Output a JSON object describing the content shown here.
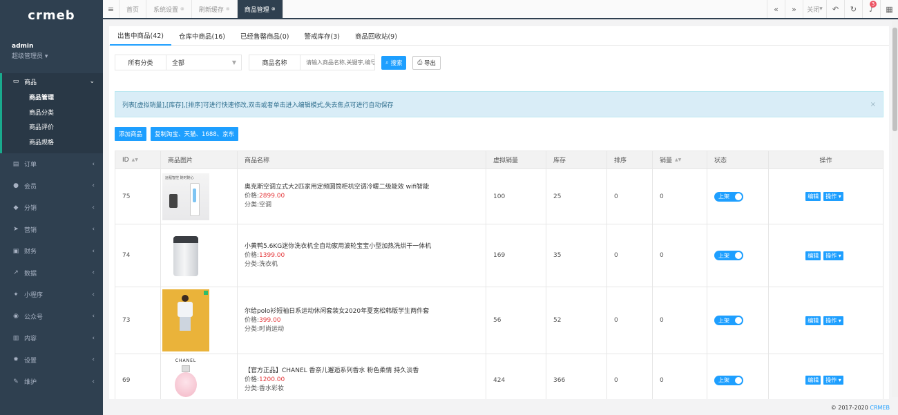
{
  "sidebar": {
    "logo": "crmeb",
    "user": {
      "name": "admin",
      "role": "超级管理员 ▾"
    },
    "active_group": {
      "label": "商品",
      "children": [
        {
          "label": "商品管理"
        },
        {
          "label": "商品分类"
        },
        {
          "label": "商品评价"
        },
        {
          "label": "商品规格"
        }
      ]
    },
    "items": [
      {
        "label": "订单",
        "icon": "order-icon"
      },
      {
        "label": "会员",
        "icon": "user-icon"
      },
      {
        "label": "分销",
        "icon": "users-icon"
      },
      {
        "label": "营销",
        "icon": "send-icon"
      },
      {
        "label": "财务",
        "icon": "money-icon"
      },
      {
        "label": "数据",
        "icon": "chart-icon"
      },
      {
        "label": "小程序",
        "icon": "miniapp-icon"
      },
      {
        "label": "公众号",
        "icon": "wechat-icon"
      },
      {
        "label": "内容",
        "icon": "book-icon"
      },
      {
        "label": "设置",
        "icon": "gear-icon"
      },
      {
        "label": "维护",
        "icon": "wrench-icon"
      }
    ]
  },
  "topbar": {
    "tabs": [
      {
        "label": "首页"
      },
      {
        "label": "系统设置"
      },
      {
        "label": "刷新缓存"
      },
      {
        "label": "商品管理"
      }
    ],
    "close_label": "关闭",
    "notifications": "3"
  },
  "sub_tabs": [
    {
      "label": "出售中商品(42)"
    },
    {
      "label": "仓库中商品(16)"
    },
    {
      "label": "已经售罄商品(0)"
    },
    {
      "label": "警戒库存(3)"
    },
    {
      "label": "商品回收站(9)"
    }
  ],
  "filters": {
    "category_label": "所有分类",
    "category_value": "全部",
    "name_label": "商品名称",
    "name_placeholder": "请输入商品名称,关键字,编号",
    "search_label": "搜索",
    "export_label": "导出"
  },
  "alert": "列表[虚拟销量],[库存],[排序]可进行快速修改,双击或者单击进入编辑模式,失去焦点可进行自动保存",
  "actions": {
    "add_label": "添加商品",
    "copy_label": "复制淘宝、天猫、1688、京东"
  },
  "table": {
    "headers": {
      "id": "ID",
      "image": "商品图片",
      "name": "商品名称",
      "virtual_sales": "虚拟销量",
      "stock": "库存",
      "sort": "排序",
      "sales": "销量",
      "status": "状态",
      "ops": "操作"
    },
    "price_prefix": "价格:",
    "category_prefix": "分类:",
    "status_label": "上架",
    "edit_label": "编辑",
    "op_label": "操作 ▾",
    "rows": [
      {
        "id": "75",
        "name": "奥克斯空调立式大2匹家用定频圆筒柜机空调冷暖二级能效 wifi智能",
        "price": "2899.00",
        "category": "空调",
        "virtual_sales": "100",
        "stock": "25",
        "sort": "0",
        "sales": "0",
        "image_text": "远程智控 随时随心"
      },
      {
        "id": "74",
        "name": "小黄鸭5.6KG迷你洗衣机全自动家用波轮宝宝小型加热洗烘干一体机",
        "price": "1399.00",
        "category": "洗衣机",
        "virtual_sales": "169",
        "stock": "35",
        "sort": "0",
        "sales": "0"
      },
      {
        "id": "73",
        "name": "尔给polo衫短袖日系运动休闲套装女2020年夏宽松韩版学生两件套",
        "price": "399.00",
        "category": "时尚运动",
        "virtual_sales": "56",
        "stock": "52",
        "sort": "0",
        "sales": "0"
      },
      {
        "id": "69",
        "name": "【官方正品】CHANEL 香奈儿邂逅系列香水 粉色柔情 持久淡香",
        "price": "1200.00",
        "category": "香水彩妆",
        "virtual_sales": "424",
        "stock": "366",
        "sort": "0",
        "sales": "0",
        "image_text": "CHANEL"
      }
    ]
  },
  "footer": {
    "copyright": "© 2017-2020",
    "brand": "CRMEB"
  }
}
